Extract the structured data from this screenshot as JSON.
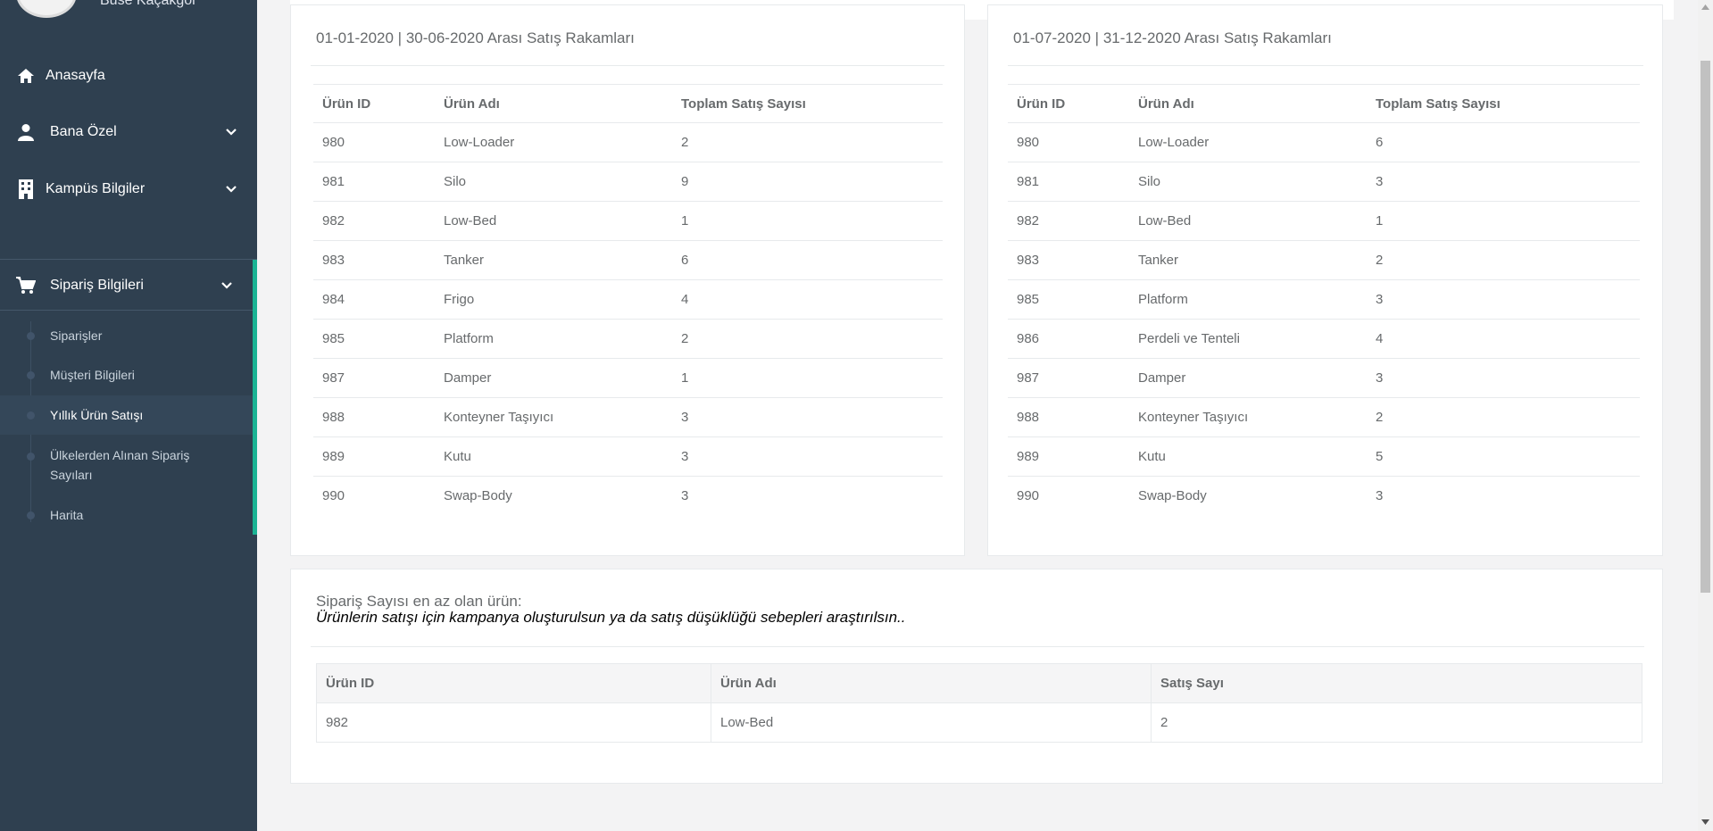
{
  "sidebar": {
    "profile_name": "Buse Kaçakgöl",
    "nav": {
      "home": "Anasayfa",
      "personal": "Bana Özel",
      "campus": "Kampüs Bilgiler",
      "orders": "Sipariş Bilgileri"
    },
    "sub_items": [
      "Siparişler",
      "Müşteri Bilgileri",
      "Yıllık Ürün Satışı",
      "Ülkelerden Alınan Sipariş Sayıları",
      "Harita"
    ],
    "active_sub_item": "Yıllık Ürün Satışı",
    "accent_color": "#1ab394"
  },
  "first_half": {
    "title": "01-01-2020 | 30-06-2020 Arası Satış Rakamları",
    "headers": [
      "Ürün ID",
      "Ürün Adı",
      "Toplam Satış Sayısı"
    ],
    "rows": [
      [
        "980",
        "Low-Loader",
        "2"
      ],
      [
        "981",
        "Silo",
        "9"
      ],
      [
        "982",
        "Low-Bed",
        "1"
      ],
      [
        "983",
        "Tanker",
        "6"
      ],
      [
        "984",
        "Frigo",
        "4"
      ],
      [
        "985",
        "Platform",
        "2"
      ],
      [
        "987",
        "Damper",
        "1"
      ],
      [
        "988",
        "Konteyner Taşıyıcı",
        "3"
      ],
      [
        "989",
        "Kutu",
        "3"
      ],
      [
        "990",
        "Swap-Body",
        "3"
      ]
    ]
  },
  "second_half": {
    "title": "01-07-2020 | 31-12-2020 Arası Satış Rakamları",
    "headers": [
      "Ürün ID",
      "Ürün Adı",
      "Toplam Satış Sayısı"
    ],
    "rows": [
      [
        "980",
        "Low-Loader",
        "6"
      ],
      [
        "981",
        "Silo",
        "3"
      ],
      [
        "982",
        "Low-Bed",
        "1"
      ],
      [
        "983",
        "Tanker",
        "2"
      ],
      [
        "985",
        "Platform",
        "3"
      ],
      [
        "986",
        "Perdeli ve Tenteli",
        "4"
      ],
      [
        "987",
        "Damper",
        "3"
      ],
      [
        "988",
        "Konteyner Taşıyıcı",
        "2"
      ],
      [
        "989",
        "Kutu",
        "5"
      ],
      [
        "990",
        "Swap-Body",
        "3"
      ]
    ]
  },
  "least_ordered": {
    "heading": "Sipariş Sayısı en az olan ürün:",
    "suggestion": "Ürünlerin satışı için kampanya oluşturulsun ya da satış düşüklüğü sebepleri araştırılsın..",
    "headers": [
      "Ürün ID",
      "Ürün Adı",
      "Satış Sayı"
    ],
    "rows": [
      [
        "982",
        "Low-Bed",
        "2"
      ]
    ]
  }
}
